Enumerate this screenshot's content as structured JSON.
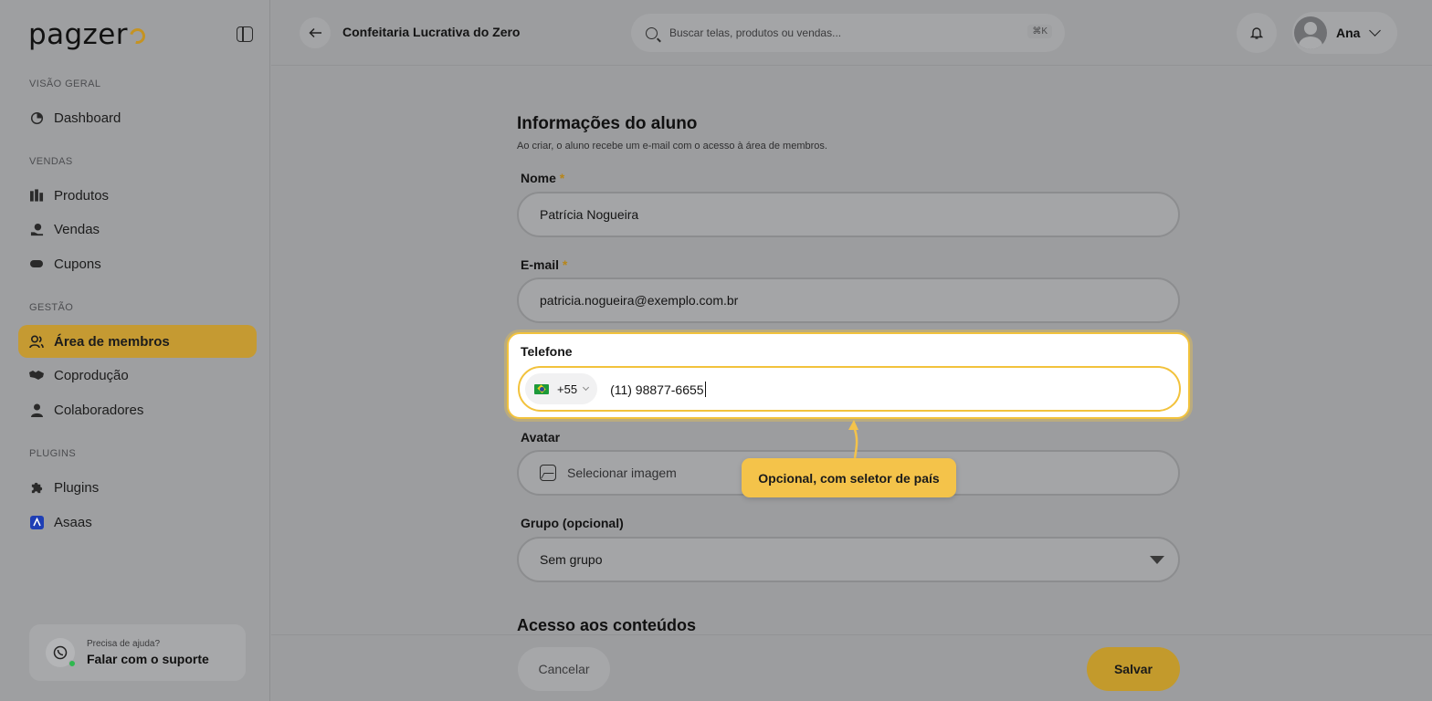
{
  "brand": {
    "logo_text": "pagzer",
    "accent": "#c59a32"
  },
  "sidebar": {
    "sections": [
      {
        "label": "VISÃO GERAL"
      },
      {
        "label": "VENDAS"
      },
      {
        "label": "GESTÃO"
      },
      {
        "label": "PLUGINS"
      }
    ],
    "items": [
      {
        "label": "Dashboard",
        "icon": "dashboard-icon"
      },
      {
        "label": "Produtos",
        "icon": "products-icon"
      },
      {
        "label": "Vendas",
        "icon": "sales-icon"
      },
      {
        "label": "Cupons",
        "icon": "coupon-icon"
      },
      {
        "label": "Área de membros",
        "icon": "members-icon",
        "active": true
      },
      {
        "label": "Coprodução",
        "icon": "handshake-icon"
      },
      {
        "label": "Colaboradores",
        "icon": "person-icon"
      },
      {
        "label": "Plugins",
        "icon": "puzzle-icon"
      },
      {
        "label": "Asaas",
        "icon": "asaas-icon"
      }
    ],
    "support": {
      "small": "Precisa de ajuda?",
      "big": "Falar com o suporte"
    }
  },
  "topbar": {
    "title": "Confeitaria Lucrativa do Zero",
    "search_placeholder": "Buscar telas, produtos ou vendas...",
    "shortcut": "⌘K",
    "user_name": "Ana"
  },
  "form": {
    "title": "Informações do aluno",
    "subtitle": "Ao criar, o aluno recebe um e-mail com o acesso à área de membros.",
    "name_label": "Nome",
    "name_value": "Patrícia Nogueira",
    "email_label": "E-mail",
    "email_value": "patricia.nogueira@exemplo.com.br",
    "required_mark": "*",
    "phone_label": "Telefone",
    "phone_dial": "+55",
    "phone_value": "(11) 98877-6655",
    "avatar_label": "Avatar",
    "avatar_placeholder": "Selecionar imagem",
    "group_label": "Grupo (opcional)",
    "group_value": "Sem grupo",
    "access_title": "Acesso aos conteúdos"
  },
  "tooltip": {
    "text": "Opcional, com seletor de país"
  },
  "footer": {
    "cancel": "Cancelar",
    "save": "Salvar"
  }
}
